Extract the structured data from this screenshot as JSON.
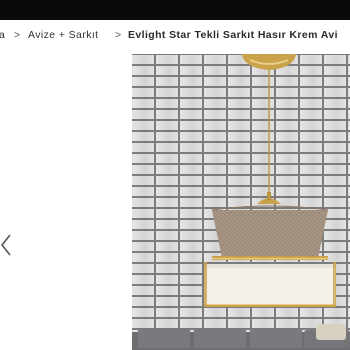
{
  "breadcrumb": {
    "partial_root": "a",
    "sep": ">",
    "category": "Avize + Sarkıt",
    "current": "Evlight Star Tekli Sarkıt Hasır Krem Avi"
  },
  "colors": {
    "topbar": "#0a0a0a",
    "gold": "#c9a24a",
    "shade_fabric": "#a39180",
    "shade_white": "#f4f1ea",
    "sofa": "#6e6e72"
  },
  "icons": {
    "prev": "chevron-left-icon"
  }
}
